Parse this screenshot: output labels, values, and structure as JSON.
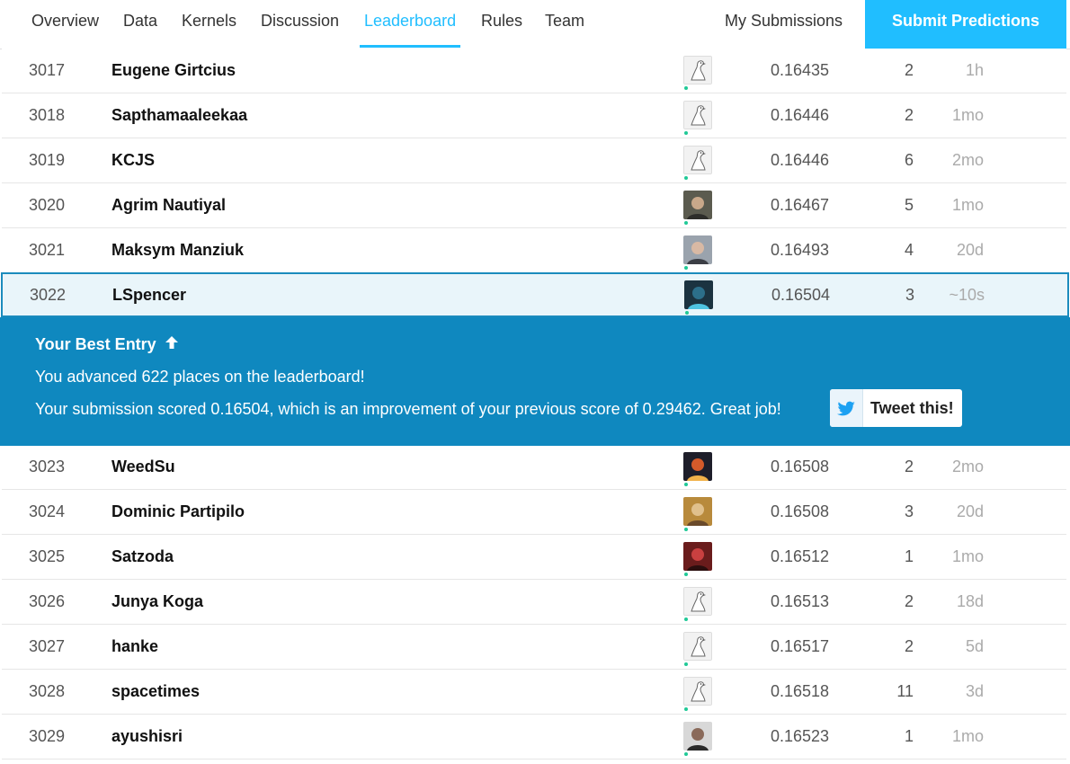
{
  "nav": {
    "tabs": [
      {
        "label": "Overview"
      },
      {
        "label": "Data"
      },
      {
        "label": "Kernels"
      },
      {
        "label": "Discussion"
      },
      {
        "label": "Leaderboard",
        "active": true
      },
      {
        "label": "Rules"
      },
      {
        "label": "Team"
      }
    ],
    "my_submissions": "My Submissions",
    "submit_predictions": "Submit Predictions"
  },
  "colors": {
    "accent": "#20beff",
    "banner": "#0f88bf",
    "highlight_bg": "#e9f5fa",
    "tier_dot": "#20c997"
  },
  "rows_top": [
    {
      "rank": "3017",
      "name": "Eugene Girtcius",
      "avatar": "goose-icon",
      "score": "0.16435",
      "entries": "2",
      "last": "1h"
    },
    {
      "rank": "3018",
      "name": "Sapthamaaleekaa",
      "avatar": "goose-icon",
      "score": "0.16446",
      "entries": "2",
      "last": "1mo"
    },
    {
      "rank": "3019",
      "name": "KCJS",
      "avatar": "goose-icon",
      "score": "0.16446",
      "entries": "6",
      "last": "2mo"
    },
    {
      "rank": "3020",
      "name": "Agrim Nautiyal",
      "avatar": "photo",
      "score": "0.16467",
      "entries": "5",
      "last": "1mo"
    },
    {
      "rank": "3021",
      "name": "Maksym Manziuk",
      "avatar": "photo",
      "score": "0.16493",
      "entries": "4",
      "last": "20d"
    },
    {
      "rank": "3022",
      "name": "LSpencer",
      "avatar": "photo",
      "score": "0.16504",
      "entries": "3",
      "last": "~10s",
      "highlight": true
    }
  ],
  "banner": {
    "title": "Your Best Entry",
    "line1": "You advanced 622 places on the leaderboard!",
    "line2": "Your submission scored 0.16504, which is an improvement of your previous score of 0.29462. Great job!",
    "tweet": "Tweet this!"
  },
  "rows_bottom": [
    {
      "rank": "3023",
      "name": "WeedSu",
      "avatar": "photo",
      "score": "0.16508",
      "entries": "2",
      "last": "2mo"
    },
    {
      "rank": "3024",
      "name": "Dominic Partipilo",
      "avatar": "photo",
      "score": "0.16508",
      "entries": "3",
      "last": "20d"
    },
    {
      "rank": "3025",
      "name": "Satzoda",
      "avatar": "photo",
      "score": "0.16512",
      "entries": "1",
      "last": "1mo"
    },
    {
      "rank": "3026",
      "name": "Junya Koga",
      "avatar": "goose-icon",
      "score": "0.16513",
      "entries": "2",
      "last": "18d"
    },
    {
      "rank": "3027",
      "name": "hanke",
      "avatar": "goose-icon",
      "score": "0.16517",
      "entries": "2",
      "last": "5d"
    },
    {
      "rank": "3028",
      "name": "spacetimes",
      "avatar": "goose-icon",
      "score": "0.16518",
      "entries": "11",
      "last": "3d"
    },
    {
      "rank": "3029",
      "name": "ayushisri",
      "avatar": "photo",
      "score": "0.16523",
      "entries": "1",
      "last": "1mo"
    }
  ]
}
